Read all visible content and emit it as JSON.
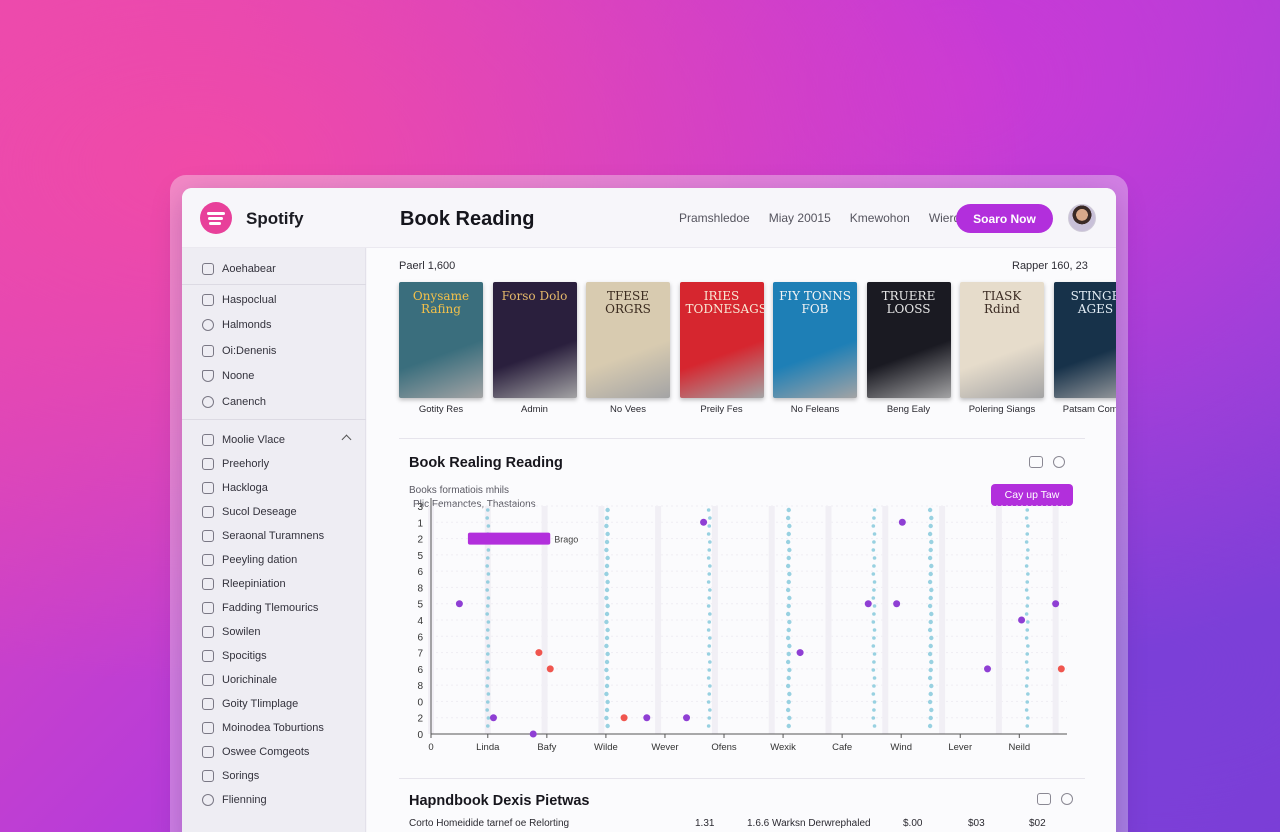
{
  "app": {
    "brand": "Spotify",
    "title": "Book Reading",
    "nav": [
      "Pramshledoe",
      "Miay 20015",
      "Kmewohon",
      "Wierd"
    ],
    "cta_label": "Soaro Now",
    "accent": "#b22fdc",
    "brand_color": "#e8409a"
  },
  "sidebar": {
    "top_items": [
      {
        "label": "Aoehabear",
        "icon": "library-icon"
      },
      {
        "label": "Haspoclual",
        "icon": "home-icon"
      },
      {
        "label": "Halmonds",
        "icon": "location-icon"
      },
      {
        "label": "Oi:Denenis",
        "icon": "bag-icon"
      },
      {
        "label": "Noone",
        "icon": "heart-icon"
      },
      {
        "label": "Canench",
        "icon": "people-icon"
      }
    ],
    "section_label": "Moolie Vlace",
    "section_items": [
      {
        "label": "Preehorly",
        "icon": "doc-icon"
      },
      {
        "label": "Hackloga",
        "icon": "doc-icon"
      },
      {
        "label": "Sucol Deseage",
        "icon": "doc-icon"
      },
      {
        "label": "Seraonal Turamnens",
        "icon": "doc-icon"
      },
      {
        "label": "Peeyling dation",
        "icon": "doc-icon"
      },
      {
        "label": "Rleepiniation",
        "icon": "doc-icon"
      },
      {
        "label": "Fadding Tlemourics",
        "icon": "doc-icon"
      },
      {
        "label": "Sowilen",
        "icon": "doc-icon"
      },
      {
        "label": "Spocitigs",
        "icon": "doc-icon"
      },
      {
        "label": "Uorichinale",
        "icon": "doc-icon"
      },
      {
        "label": "Goity Tlimplage",
        "icon": "doc-icon"
      },
      {
        "label": "Moinodea Toburtions",
        "icon": "doc-icon"
      },
      {
        "label": "Oswee Comgeots",
        "icon": "chat-icon"
      },
      {
        "label": "Sorings",
        "icon": "doc-icon"
      },
      {
        "label": "Flienning",
        "icon": "settings-icon"
      }
    ]
  },
  "main": {
    "meta_left": "Paerl 1,600",
    "meta_right": "Rapper 160, 23",
    "books": [
      {
        "title": "Gotity Res",
        "cover_text": "Onysame Rafing",
        "bg": "#3a6e7d",
        "fg": "#f2c04a"
      },
      {
        "title": "Admin",
        "cover_text": "Forso Dolo",
        "bg": "#2a1f3d",
        "fg": "#e4b86a"
      },
      {
        "title": "No Vees",
        "cover_text": "TFESE ORGRS",
        "bg": "#d8cbb0",
        "fg": "#3a2a1e"
      },
      {
        "title": "Preily Fes",
        "cover_text": "IRIES TODNESAGS",
        "bg": "#d6262f",
        "fg": "#f8e9d6"
      },
      {
        "title": "No Feleans",
        "cover_text": "FIY TONNS FOB",
        "bg": "#1e7fb6",
        "fg": "#f4f4f4"
      },
      {
        "title": "Beng Ealy",
        "cover_text": "TRUERE LOOSS",
        "bg": "#1a1a22",
        "fg": "#e8e8e8"
      },
      {
        "title": "Polering Siangs",
        "cover_text": "TIASK Rdind",
        "bg": "#e6dccb",
        "fg": "#3a2a22"
      },
      {
        "title": "Patsam Comea",
        "cover_text": "STINGE AGES",
        "bg": "#17324a",
        "fg": "#e4eef6"
      }
    ],
    "chart_section": {
      "title": "Book Realing Reading",
      "note": "Books formatiois mhils",
      "sub_note": "Plic Femanctes, Thastaions",
      "copy_label": "Cay up Taw"
    },
    "table_section": {
      "title": "Hapndbook Dexis Pietwas",
      "row": [
        "Corto Homeidide tarnef oe Relorting",
        "1.31",
        "1.6.6 Warksn Derwrephaled",
        "$.00",
        "$03",
        "$02"
      ]
    }
  },
  "chart_data": {
    "type": "scatter",
    "title": "Book Realing Reading",
    "y_tick_labels": [
      "3",
      "1",
      "2",
      "5",
      "6",
      "8",
      "5",
      "4",
      "6",
      "7",
      "6",
      "8",
      "0",
      "2",
      "0"
    ],
    "categories": [
      "0",
      "Linda",
      "Bafy",
      "Wilde",
      "Wever",
      "Ofens",
      "Wexik",
      "Cafe",
      "Wind",
      "Lever",
      "Neild"
    ],
    "callout": {
      "label": "Brago",
      "start": 0.65,
      "end": 2.1,
      "row": "2"
    },
    "series": [
      {
        "color": "#7fc7d9",
        "type": "dense-columns",
        "columns": [
          1,
          3.1,
          4.9,
          6.3,
          7.8,
          8.8,
          10.5
        ]
      },
      {
        "color": "#8f3fd4",
        "points": [
          [
            0.5,
            "5"
          ],
          [
            1.1,
            "2"
          ],
          [
            1.8,
            "0"
          ],
          [
            3.8,
            "2"
          ],
          [
            4.5,
            "2"
          ],
          [
            4.8,
            "1"
          ],
          [
            6.5,
            "7"
          ],
          [
            8.2,
            "5"
          ],
          [
            8.3,
            "1"
          ],
          [
            9.8,
            "6"
          ],
          [
            10.4,
            "4"
          ],
          [
            11.0,
            "5"
          ],
          [
            7.7,
            "5"
          ]
        ]
      },
      {
        "color": "#f0564f",
        "points": [
          [
            2.1,
            "6"
          ],
          [
            1.9,
            "7"
          ],
          [
            3.4,
            "2"
          ],
          [
            11.1,
            "6"
          ]
        ]
      }
    ],
    "grid": true
  }
}
